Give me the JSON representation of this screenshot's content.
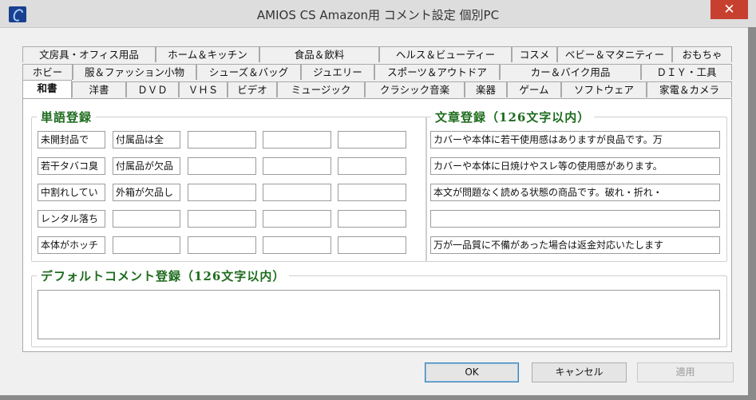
{
  "window": {
    "title": "AMIOS CS Amazon用 コメント設定 個別PC",
    "close_glyph": "✕"
  },
  "tabs": {
    "row1": [
      "文房具・オフィス用品",
      "ホーム＆キッチン",
      "食品＆飲料",
      "ヘルス＆ビューティー",
      "コスメ",
      "ベビー＆マタニティー",
      "おもちゃ"
    ],
    "row2": [
      "ホビー",
      "服＆ファッション小物",
      "シューズ＆バッグ",
      "ジュエリー",
      "スポーツ＆アウトドア",
      "カー＆バイク用品",
      "ＤＩＹ・工具"
    ],
    "row3": [
      "和書",
      "洋書",
      "ＤＶＤ",
      "ＶＨＳ",
      "ビデオ",
      "ミュージック",
      "クラシック音楽",
      "楽器",
      "ゲーム",
      "ソフトウェア",
      "家電＆カメラ"
    ],
    "active": "和書"
  },
  "word_group": {
    "title": "単語登録",
    "rows": [
      [
        "未開封品で",
        "付属品は全",
        "",
        "",
        ""
      ],
      [
        "若干タバコ臭",
        "付属品が欠品",
        "",
        "",
        ""
      ],
      [
        "中割れしてい",
        "外箱が欠品し",
        "",
        "",
        ""
      ],
      [
        "レンタル落ち",
        "",
        "",
        "",
        ""
      ],
      [
        "本体がホッチ",
        "",
        "",
        "",
        ""
      ]
    ]
  },
  "sentence_group": {
    "title": "文章登録（126文字以内）",
    "rows": [
      "カバーや本体に若干使用感はありますが良品です。万",
      "カバーや本体に日焼けやスレ等の使用感があります。",
      "本文が問題なく読める状態の商品です。破れ・折れ・",
      "",
      "万が一品質に不備があった場合は返金対応いたします"
    ]
  },
  "default_group": {
    "title": "デフォルトコメント登録（126文字以内）",
    "value": ""
  },
  "buttons": {
    "ok": "OK",
    "cancel": "キャンセル",
    "apply": "適用"
  },
  "colors": {
    "group_title": "#1d6b1d",
    "close_button": "#c7402f"
  }
}
